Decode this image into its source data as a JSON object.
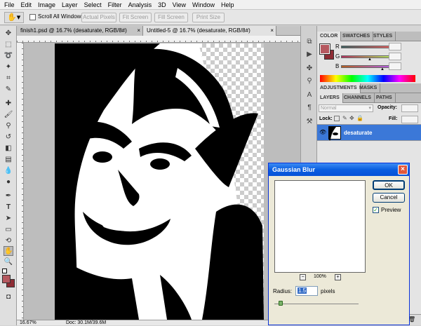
{
  "menu": [
    "File",
    "Edit",
    "Image",
    "Layer",
    "Select",
    "Filter",
    "Analysis",
    "3D",
    "View",
    "Window",
    "Help"
  ],
  "options_bar": {
    "scroll_all_windows": "Scroll All Windows",
    "buttons": [
      "Actual Pixels",
      "Fit Screen",
      "Fill Screen",
      "Print Size"
    ]
  },
  "doc_tabs": [
    {
      "label": "finish1.psd @ 16.7% (desaturate, RGB/8#)",
      "close": "×"
    },
    {
      "label": "Untitled-5 @ 16.7% (desaturate, RGB/8#)",
      "close": "×"
    }
  ],
  "status": {
    "zoom": "16.67%",
    "doc": "Doc: 30.1M/39.6M"
  },
  "color_panel": {
    "tabs": [
      "COLOR",
      "SWATCHES",
      "STYLES"
    ],
    "channels": [
      {
        "label": "R",
        "value": "",
        "fraction": 0.93
      },
      {
        "label": "G",
        "value": "",
        "fraction": 0.5
      },
      {
        "label": "B",
        "value": "",
        "fraction": 0.7
      }
    ],
    "fg_color": "#b5585f",
    "bg_color": "#8e2c34"
  },
  "adjust_tabs": [
    "ADJUSTMENTS",
    "MASKS"
  ],
  "layers_panel": {
    "tabs": [
      "LAYERS",
      "CHANNELS",
      "PATHS"
    ],
    "blend_mode": "Normal",
    "opacity_label": "Opacity:",
    "lock_label": "Lock:",
    "fill_label": "Fill:",
    "layer_name": "desaturate"
  },
  "dialog": {
    "title": "Gaussian Blur",
    "close": "×",
    "ok": "OK",
    "cancel": "Cancel",
    "preview_label": "Preview",
    "preview_checked": true,
    "zoom": "100%",
    "zoom_out": "−",
    "zoom_in": "+",
    "radius_label": "Radius:",
    "radius_value": "1.5",
    "radius_unit": "pixels",
    "radius_fraction": 0.06
  },
  "colors": {
    "accent_blue": "#0a5ee0",
    "layer_selected": "#3b78d8"
  }
}
